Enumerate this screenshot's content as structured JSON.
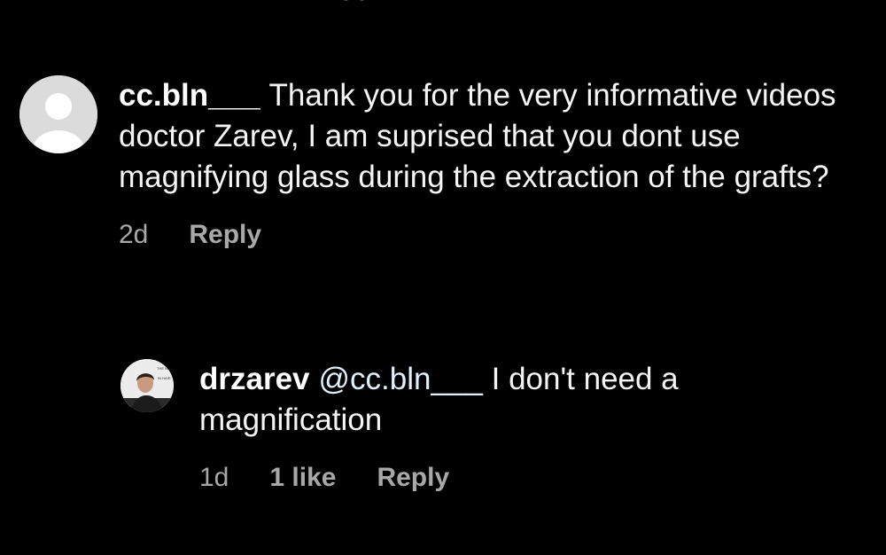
{
  "comment": {
    "username": "cc.bln___",
    "text": "Thank you for the very informative videos doctor Zarev, I am suprised that you dont use magnifying glass during the extraction of the grafts?",
    "time": "2d",
    "reply_label": "Reply",
    "avatar_icon": "default-user-avatar-icon"
  },
  "reply": {
    "username": "drzarev",
    "mention": "@cc.bln___",
    "text": "I don't need a magnification",
    "time": "1d",
    "likes": "1 like",
    "reply_label": "Reply",
    "avatar_icon": "profile-photo-avatar",
    "avatar_caption_line1": "THE NEW",
    "avatar_caption_line2": "IN HAIR"
  },
  "colors": {
    "background": "#000000",
    "primary_text": "#f5f5f5",
    "secondary_text": "#a8a8a8",
    "default_avatar": "#dbdbdb"
  }
}
